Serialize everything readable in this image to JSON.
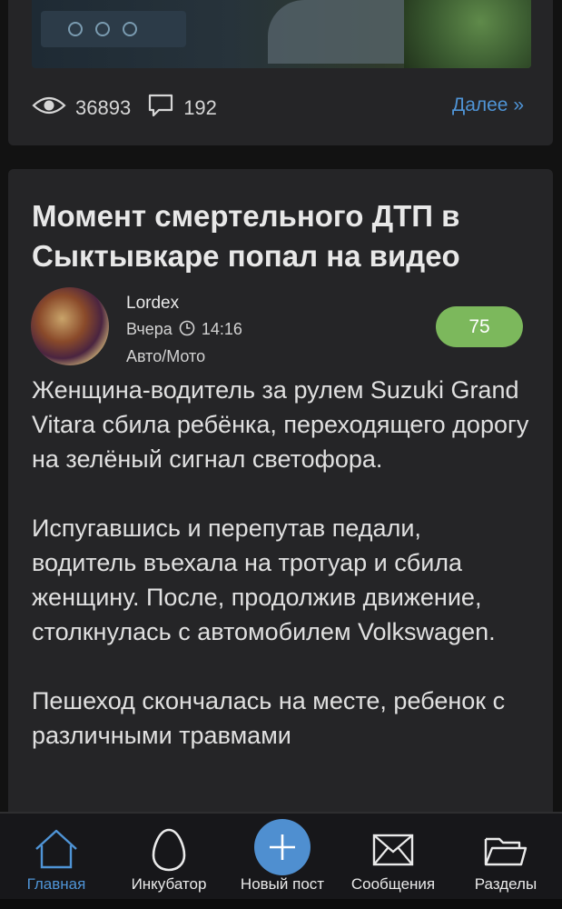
{
  "previous_post": {
    "views": "36893",
    "comments": "192",
    "more_label": "Далее »"
  },
  "post": {
    "title": "Момент смертельного ДТП  в Сыктывкаре попал на видео",
    "author": "Lordex",
    "date": "Вчера",
    "time": "14:16",
    "category": "Авто/Мото",
    "rating": "75",
    "paragraphs": [
      "Женщина-водитель за рулем Suzuki Grand Vitara сбила ребёнка, переходящего дорогу на зелёный сигнал светофора.",
      "Испугавшись и перепутав педали, водитель въехала на тротуар и сбила женщину. После, продолжив движение, столкнулась с автомобилем Volkswagen.",
      "Пешеход скончалась на месте, ребенок с различными травмами"
    ]
  },
  "nav": {
    "home": "Главная",
    "incubator": "Инкубатор",
    "new_post": "Новый пост",
    "messages": "Сообщения",
    "sections": "Разделы"
  },
  "colors": {
    "accent": "#4f94d6",
    "rating_badge": "#7cb85c",
    "card": "#252527"
  },
  "icons": [
    "eye-icon",
    "comment-icon",
    "clock-icon",
    "home-icon",
    "egg-icon",
    "plus-icon",
    "envelope-icon",
    "folder-icon"
  ]
}
